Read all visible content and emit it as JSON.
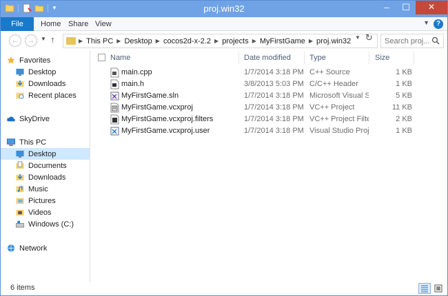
{
  "window": {
    "title": "proj.win32"
  },
  "ribbon": {
    "tabs": [
      "File",
      "Home",
      "Share",
      "View"
    ],
    "help": "?"
  },
  "nav": {
    "path": [
      "This PC",
      "Desktop",
      "cocos2d-x-2.2",
      "projects",
      "MyFirstGame",
      "proj.win32"
    ],
    "search_placeholder": "Search proj..."
  },
  "sidebar": {
    "favorites": {
      "label": "Favorites",
      "items": [
        "Desktop",
        "Downloads",
        "Recent places"
      ]
    },
    "skydrive": "SkyDrive",
    "thispc": {
      "label": "This PC",
      "items": [
        "Desktop",
        "Documents",
        "Downloads",
        "Music",
        "Pictures",
        "Videos",
        "Windows (C:)"
      ],
      "selected": "Desktop"
    },
    "network": "Network"
  },
  "columns": {
    "name": "Name",
    "date": "Date modified",
    "type": "Type",
    "size": "Size"
  },
  "files": [
    {
      "name": "main.cpp",
      "date": "1/7/2014 3:18 PM",
      "type": "C++ Source",
      "size": "1 KB",
      "icon": "cpp-file-icon"
    },
    {
      "name": "main.h",
      "date": "3/8/2013 5:03 PM",
      "type": "C/C++ Header",
      "size": "1 KB",
      "icon": "header-file-icon"
    },
    {
      "name": "MyFirstGame.sln",
      "date": "1/7/2014 3:18 PM",
      "type": "Microsoft Visual St...",
      "size": "5 KB",
      "icon": "sln-file-icon"
    },
    {
      "name": "MyFirstGame.vcxproj",
      "date": "1/7/2014 3:18 PM",
      "type": "VC++ Project",
      "size": "11 KB",
      "icon": "vcxproj-file-icon"
    },
    {
      "name": "MyFirstGame.vcxproj.filters",
      "date": "1/7/2014 3:18 PM",
      "type": "VC++ Project Filte...",
      "size": "2 KB",
      "icon": "filters-file-icon"
    },
    {
      "name": "MyFirstGame.vcxproj.user",
      "date": "1/7/2014 3:18 PM",
      "type": "Visual Studio Proje...",
      "size": "1 KB",
      "icon": "user-file-icon"
    }
  ],
  "status": {
    "count": "6 items"
  },
  "colors": {
    "titlebar": "#6fa3e6",
    "file_tab": "#1979ca",
    "close": "#c7473d",
    "selected": "#cde8ff"
  }
}
